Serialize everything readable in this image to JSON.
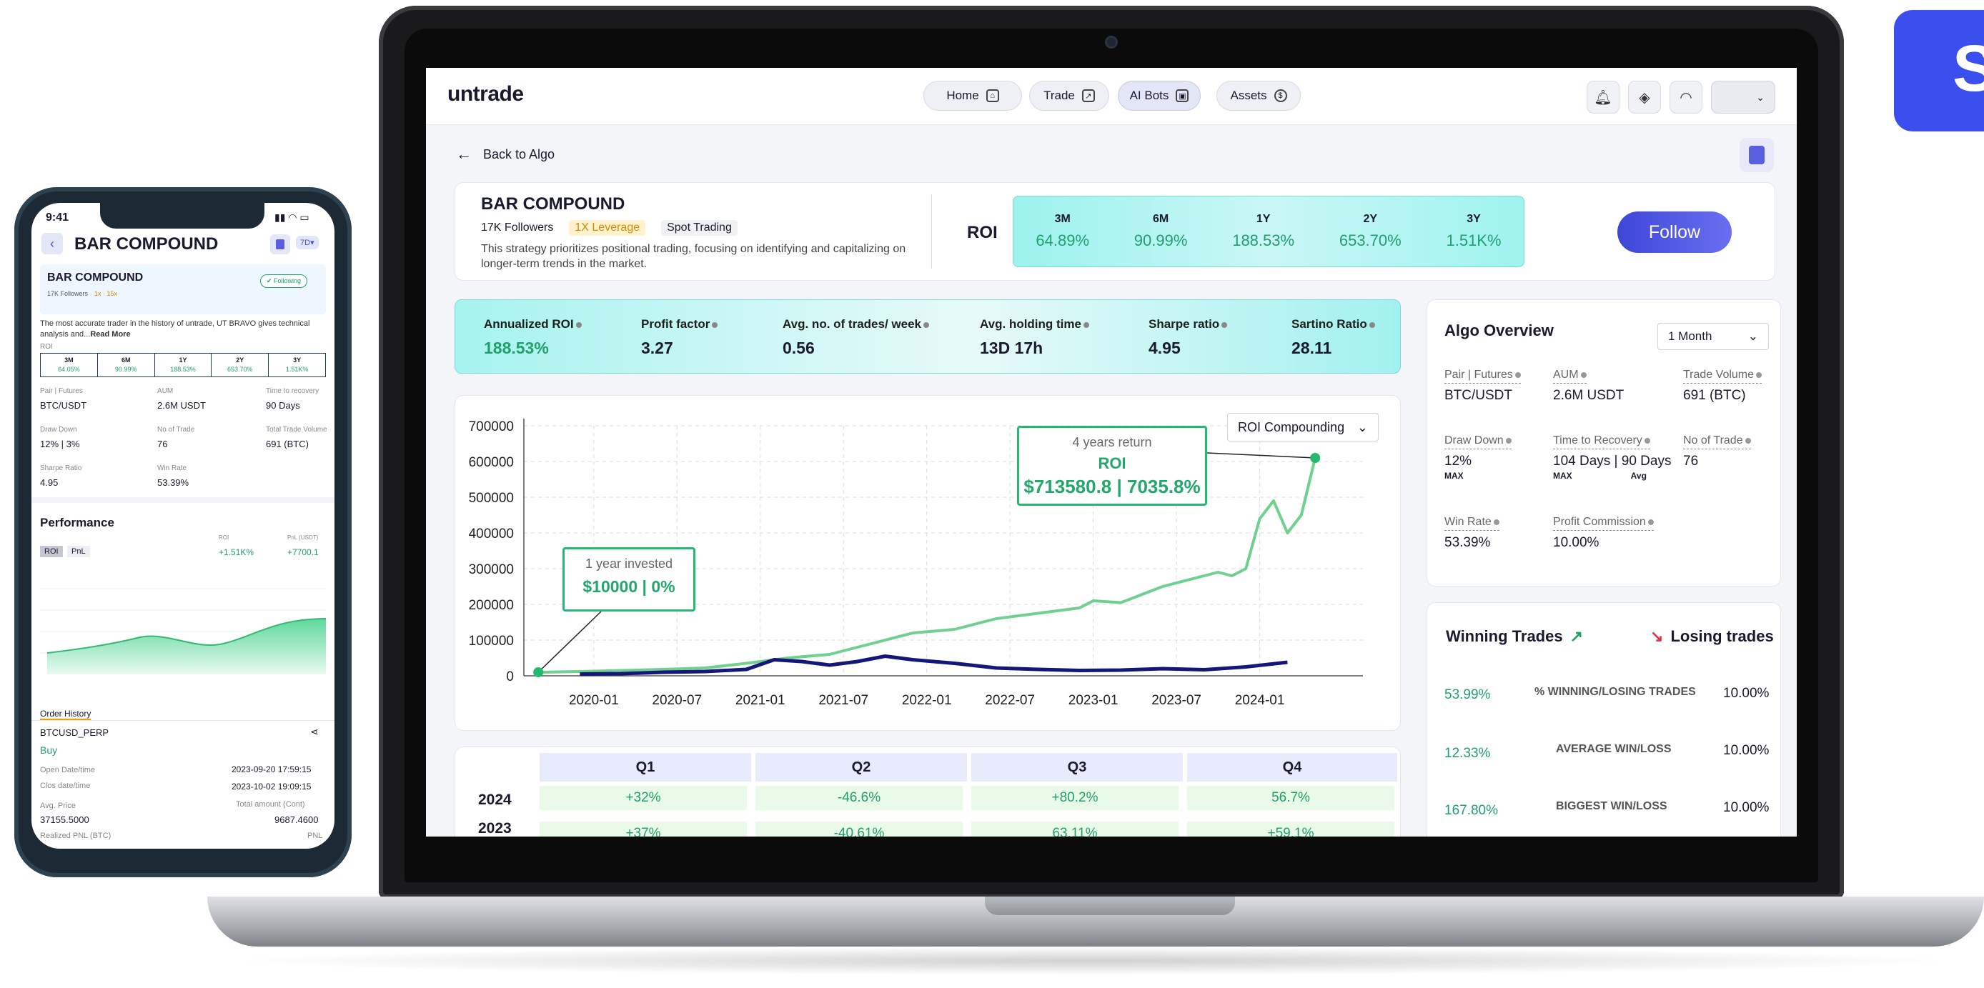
{
  "app": {
    "logo": "untrade",
    "nav": [
      "Home",
      "Trade",
      "AI Bots",
      "Assets"
    ],
    "back_label": "Back to Algo"
  },
  "algo": {
    "name": "BAR COMPOUND",
    "followers": "17K Followers",
    "leverage": "1X Leverage",
    "type": "Spot Trading",
    "description": "This strategy prioritizes positional trading, focusing on identifying and capitalizing on longer-term trends in the market.",
    "roi_label": "ROI",
    "roi": [
      {
        "period": "3M",
        "value": "64.89%"
      },
      {
        "period": "6M",
        "value": "90.99%"
      },
      {
        "period": "1Y",
        "value": "188.53%"
      },
      {
        "period": "2Y",
        "value": "653.70%"
      },
      {
        "period": "3Y",
        "value": "1.51K%"
      }
    ],
    "follow_label": "Follow"
  },
  "stats": [
    {
      "label": "Annualized ROI",
      "value": "188.53%"
    },
    {
      "label": "Profit factor",
      "value": "3.27"
    },
    {
      "label": "Avg. no. of trades/ week",
      "value": "0.56"
    },
    {
      "label": "Avg. holding time",
      "value": "13D 17h"
    },
    {
      "label": "Sharpe ratio",
      "value": "4.95"
    },
    {
      "label": "Sartino Ratio",
      "value": "28.11"
    }
  ],
  "chart": {
    "dropdown": "ROI Compounding",
    "callout_start": {
      "title": "1 year invested",
      "value": "$10000 | 0%"
    },
    "callout_end": {
      "title": "4 years return",
      "roi": "ROI",
      "value": "$713580.8 | 7035.8%"
    }
  },
  "chart_data": {
    "type": "line",
    "title": "",
    "xlabel": "",
    "ylabel": "",
    "ylim": [
      0,
      700000
    ],
    "yticks": [
      "700000",
      "600000",
      "500000",
      "400000",
      "300000",
      "200000",
      "100000",
      "0"
    ],
    "xticks": [
      "2020-01",
      "2020-07",
      "2021-01",
      "2021-07",
      "2022-01",
      "2022-07",
      "2023-01",
      "2023-07",
      "2024-01"
    ],
    "colors": {
      "roi": "#6fd08f",
      "benchmark": "#15167a"
    },
    "series": [
      {
        "key": "roi",
        "x": [
          "2019-09",
          "2019-12",
          "2020-03",
          "2020-06",
          "2020-09",
          "2020-12",
          "2021-03",
          "2021-06",
          "2021-09",
          "2021-12",
          "2022-03",
          "2022-06",
          "2022-09",
          "2022-12",
          "2023-01",
          "2023-03",
          "2023-06",
          "2023-09",
          "2023-10",
          "2023-11",
          "2023-12",
          "2024-01",
          "2024-02",
          "2024-03",
          "2024-04",
          "2024-05"
        ],
        "values": [
          10000,
          12000,
          15000,
          18000,
          22000,
          35000,
          50000,
          60000,
          90000,
          120000,
          130000,
          160000,
          175000,
          190000,
          210000,
          205000,
          250000,
          280000,
          290000,
          280000,
          300000,
          440000,
          490000,
          400000,
          450000,
          610000
        ]
      },
      {
        "key": "benchmark",
        "x": [
          "2019-12",
          "2020-03",
          "2020-06",
          "2020-09",
          "2020-12",
          "2021-02",
          "2021-04",
          "2021-06",
          "2021-08",
          "2021-10",
          "2021-12",
          "2022-03",
          "2022-06",
          "2022-09",
          "2022-12",
          "2023-03",
          "2023-06",
          "2023-09",
          "2023-12",
          "2024-03"
        ],
        "values": [
          5000,
          6000,
          10000,
          12000,
          18000,
          45000,
          40000,
          30000,
          40000,
          55000,
          45000,
          35000,
          22000,
          18000,
          15000,
          16000,
          20000,
          17000,
          25000,
          38000
        ]
      }
    ]
  },
  "quarters": {
    "headers": [
      "Q1",
      "Q2",
      "Q3",
      "Q4"
    ],
    "rows": [
      {
        "year": "2024",
        "values": [
          "+32%",
          "-46.6%",
          "+80.2%",
          "56.7%"
        ]
      },
      {
        "year": "2023",
        "values": [
          "+37%",
          "-40.61%",
          "63.11%",
          "+59.1%"
        ]
      }
    ]
  },
  "overview": {
    "title": "Algo Overview",
    "period": "1 Month",
    "items": [
      {
        "label": "Pair | Futures",
        "value": "BTC/USDT"
      },
      {
        "label": "AUM",
        "value": "2.6M USDT"
      },
      {
        "label": "Trade Volume",
        "value": "691 (BTC)"
      },
      {
        "label": "Draw Down",
        "value": "12%",
        "sub": "MAX"
      },
      {
        "label": "Time to Recovery",
        "value": "104 Days | 90 Days",
        "sub": "MAX",
        "sub2": "Avg"
      },
      {
        "label": "No of Trade",
        "value": "76"
      },
      {
        "label": "Win Rate",
        "value": "53.39%"
      },
      {
        "label": "Profit Commission",
        "value": "10.00%"
      }
    ]
  },
  "winloss": {
    "winning_label": "Winning Trades",
    "losing_label": "Losing trades",
    "rows": [
      {
        "left": "53.99%",
        "label": "% WINNING/LOSING TRADES",
        "right": "10.00%"
      },
      {
        "left": "12.33%",
        "label": "AVERAGE WIN/LOSS",
        "right": "10.00%"
      },
      {
        "left": "167.80%",
        "label": "BIGGEST WIN/LOSS",
        "right": "10.00%"
      }
    ]
  },
  "phone": {
    "time": "9:41",
    "title": "BAR COMPOUND",
    "period_badge": "7D",
    "card_name": "BAR COMPOUND",
    "card_followers": "17K Followers",
    "card_tag": "1x · 15x",
    "following_label": "Following",
    "description": "The most accurate trader in the history of untrade, UT BRAVO gives technical analysis and...",
    "read_more": "Read More",
    "roi_label": "ROI",
    "roi": [
      {
        "p": "3M",
        "v": "64.05%"
      },
      {
        "p": "6M",
        "v": "90.99%"
      },
      {
        "p": "1Y",
        "v": "188.53%"
      },
      {
        "p": "2Y",
        "v": "653.70%"
      },
      {
        "p": "3Y",
        "v": "1.51K%"
      }
    ],
    "info": [
      {
        "label": "Pair | Futures",
        "value": "BTC/USDT"
      },
      {
        "label": "AUM",
        "value": "2.6M USDT"
      },
      {
        "label": "Time to recovery",
        "value": "90 Days"
      },
      {
        "label": "Draw Down",
        "value": "12% | 3%"
      },
      {
        "label": "No of Trade",
        "value": "76"
      },
      {
        "label": "Total Trade Volume",
        "value": "691 (BTC)"
      },
      {
        "label": "Sharpe Ratio",
        "value": "4.95"
      },
      {
        "label": "Win Rate",
        "value": "53.39%"
      }
    ],
    "performance": "Performance",
    "tab_roi": "ROI",
    "tab_pnl": "PnL",
    "perf_roi_label": "ROI",
    "perf_roi_value": "+1.51K%",
    "perf_pnl_label": "PnL (USDT)",
    "perf_pnl_value": "+7700.1",
    "order_history": "Order History",
    "symbol": "BTCUSD_PERP",
    "side": "Buy",
    "open_label": "Open Date/time",
    "open_value": "2023-09-20 17:59:15",
    "close_label": "Clos date/time",
    "close_value": "2023-10-02 19:09:15",
    "avg_price_label": "Avg. Price",
    "avg_price_value": "37155.5000",
    "total_label": "Total amount  (Cont)",
    "total_value": "9687.4600",
    "realized_label": "Realized PNL (BTC)",
    "pnl_label": "PNL"
  },
  "corner_tile": "S"
}
